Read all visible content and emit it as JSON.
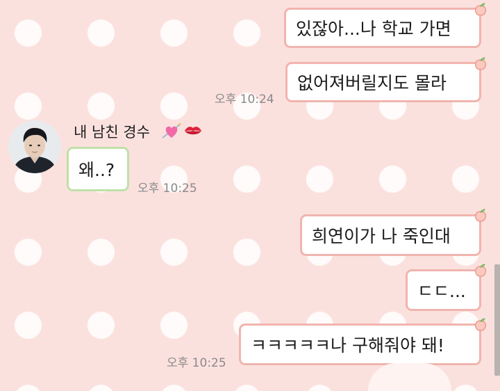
{
  "chat": {
    "sender_name": "내 남친 경수",
    "messages_group1": [
      {
        "text": "있잖아...나 학교 가면"
      },
      {
        "text": "없어져버릴지도 몰라"
      }
    ],
    "time1": "오후 10:24",
    "friend_message": "왜..?",
    "time2": "오후 10:25",
    "messages_group2": [
      {
        "text": "희연이가 나 죽인대"
      },
      {
        "text": "ㄷㄷ..."
      },
      {
        "text": "ㅋㅋㅋㅋㅋ나 구해줘야 돼!"
      }
    ],
    "time3": "오후 10:25"
  },
  "icons": {
    "bubble_tail": "peach-icon",
    "name_emoji_1": "heart-with-arrow-icon",
    "name_emoji_2": "kiss-mark-icon"
  },
  "colors": {
    "background": "#fbe1de",
    "my_bubble_border": "#f1b4ae",
    "friend_bubble_border": "#bfe0a8",
    "timestamp": "#8a8a8a"
  }
}
